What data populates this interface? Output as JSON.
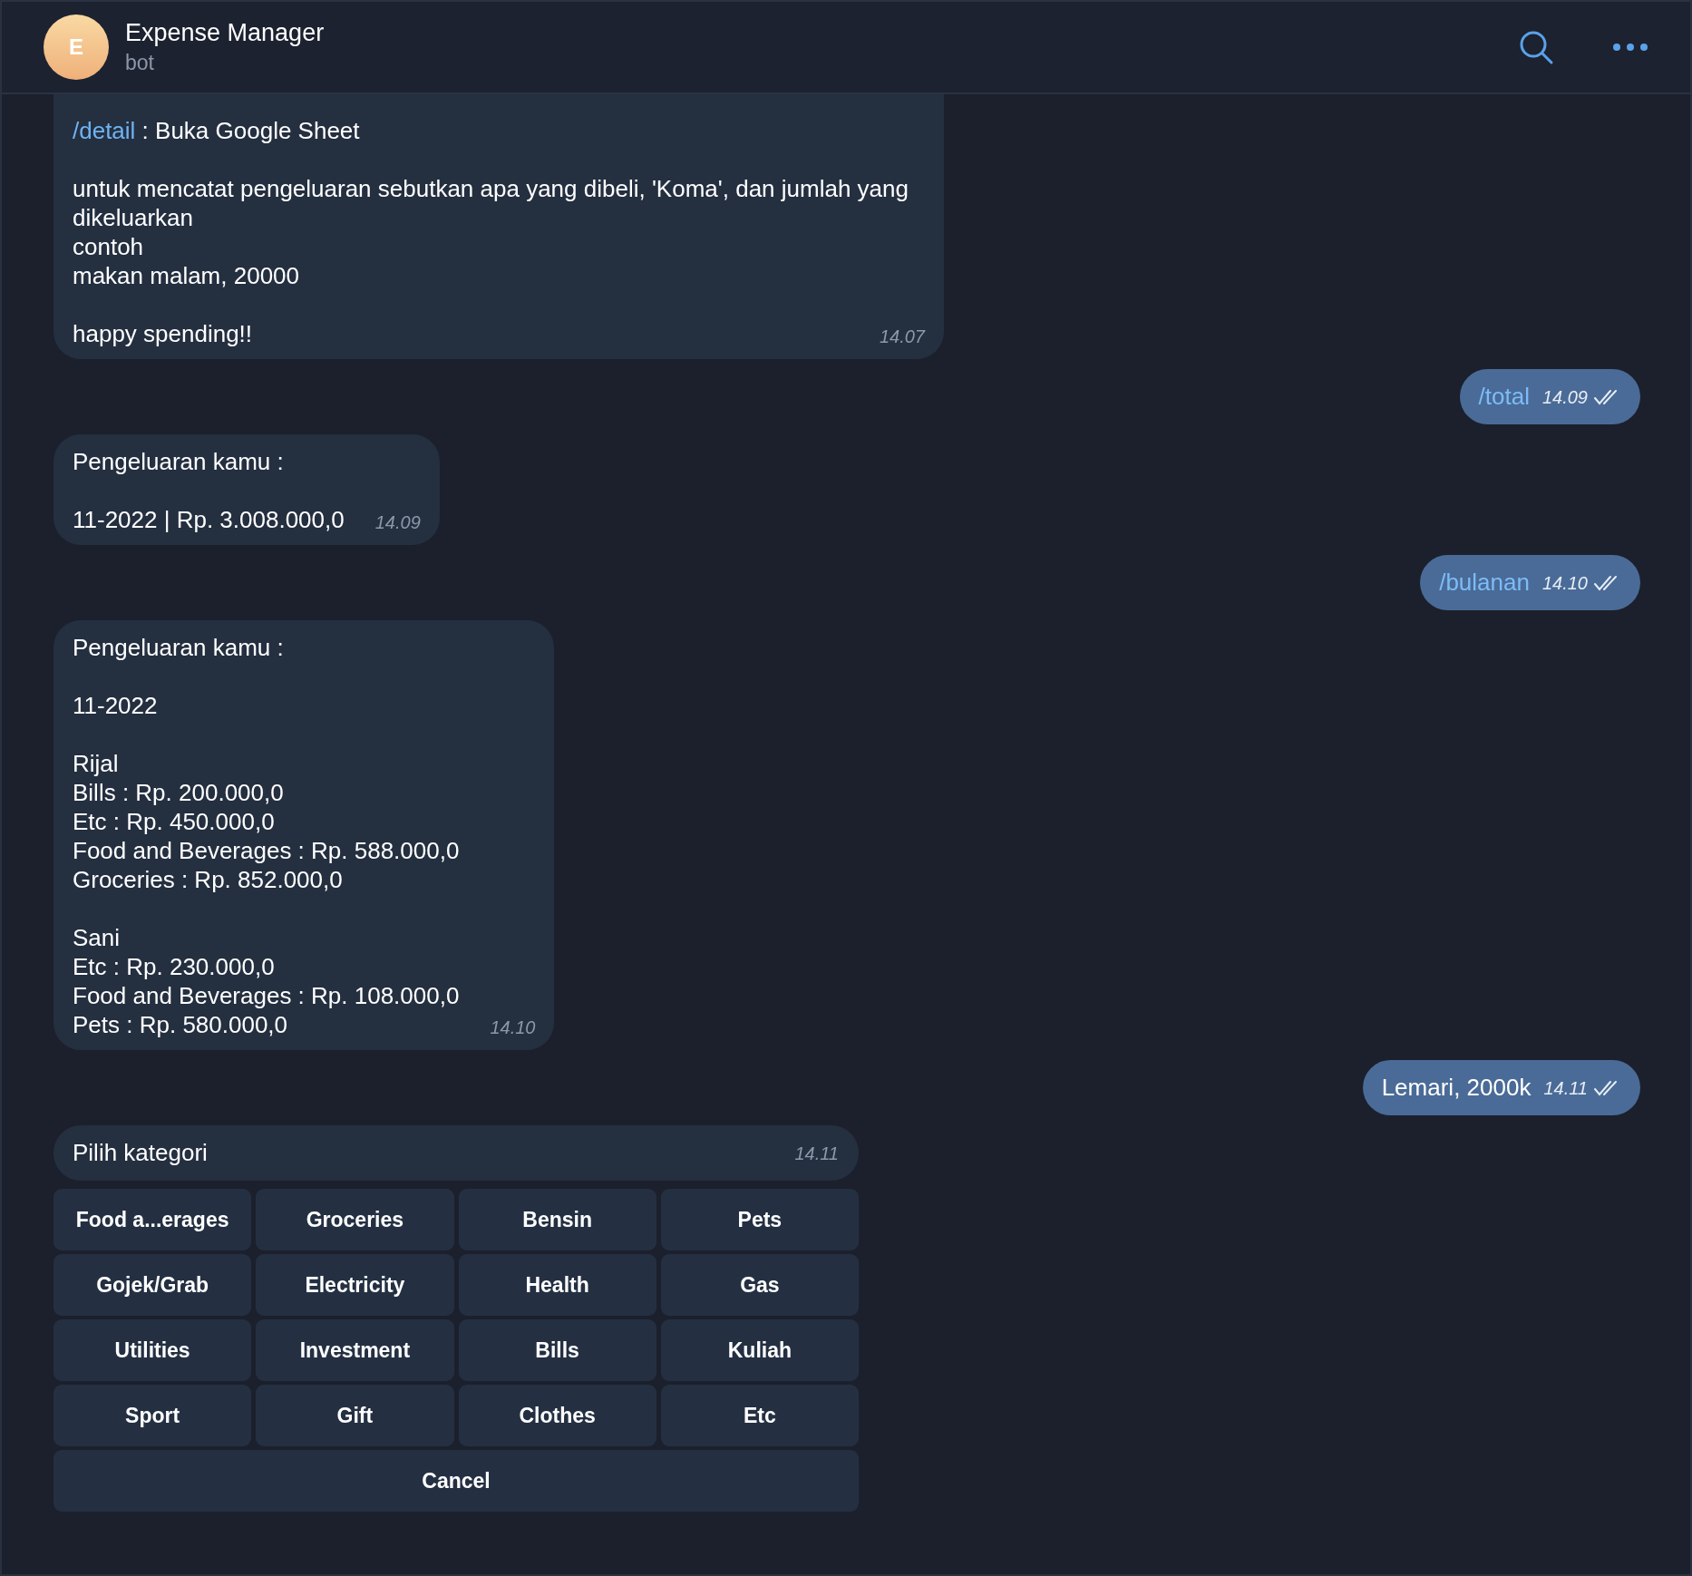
{
  "header": {
    "avatar_letter": "E",
    "title": "Expense Manager",
    "subtitle": "bot"
  },
  "messages": [
    {
      "kind": "incoming",
      "cut_top": true,
      "paragraphs": [
        {
          "command": "/detail",
          "text": " : Buka Google Sheet"
        },
        {
          "text": "untuk mencatat pengeluaran sebutkan apa yang dibeli, 'Koma', dan jumlah yang dikeluarkan\ncontoh\nmakan malam, 20000"
        },
        {
          "text": "happy spending!!"
        }
      ],
      "time": "14.07"
    },
    {
      "kind": "outgoing",
      "command": true,
      "text": "/total",
      "time": "14.09",
      "read": true
    },
    {
      "kind": "incoming",
      "paragraphs": [
        {
          "text": "Pengeluaran kamu :"
        },
        {
          "text": "11-2022 | Rp. 3.008.000,0"
        }
      ],
      "time": "14.09"
    },
    {
      "kind": "outgoing",
      "command": true,
      "text": "/bulanan",
      "time": "14.10",
      "read": true
    },
    {
      "kind": "incoming",
      "paragraphs": [
        {
          "text": "Pengeluaran kamu :"
        },
        {
          "text": "11-2022"
        },
        {
          "text": "Rijal\nBills : Rp. 200.000,0\nEtc : Rp. 450.000,0\nFood and Beverages : Rp. 588.000,0\nGroceries : Rp. 852.000,0"
        },
        {
          "text": "Sani\nEtc : Rp. 230.000,0\nFood and Beverages : Rp. 108.000,0\nPets : Rp. 580.000,0"
        }
      ],
      "time": "14.10"
    },
    {
      "kind": "outgoing",
      "command": false,
      "text": "Lemari, 2000k",
      "time": "14.11",
      "read": true
    },
    {
      "kind": "keyboard",
      "text": "Pilih kategori",
      "time": "14.11",
      "rows": [
        [
          "Food a...erages",
          "Groceries",
          "Bensin",
          "Pets"
        ],
        [
          "Gojek/Grab",
          "Electricity",
          "Health",
          "Gas"
        ],
        [
          "Utilities",
          "Investment",
          "Bills",
          "Kuliah"
        ],
        [
          "Sport",
          "Gift",
          "Clothes",
          "Etc"
        ],
        [
          "Cancel"
        ]
      ]
    }
  ]
}
